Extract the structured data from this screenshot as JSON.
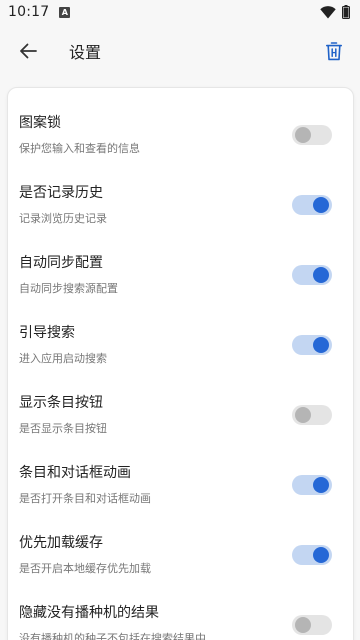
{
  "status_bar": {
    "time": "10:17",
    "notification_icon": "A",
    "icons": [
      "wifi-icon",
      "battery-icon"
    ]
  },
  "app_bar": {
    "title": "设置",
    "back_icon": "arrow-left-icon",
    "action_icon": "trash-icon"
  },
  "colors": {
    "accent": "#2668d6",
    "toggle_on_track": "#c3d6f2",
    "toggle_off_track": "#e4e4e4",
    "toggle_off_knob": "#b5b5b5"
  },
  "settings": [
    {
      "title": "图案锁",
      "description": "保护您输入和查看的信息",
      "enabled": false
    },
    {
      "title": "是否记录历史",
      "description": "记录浏览历史记录",
      "enabled": true
    },
    {
      "title": "自动同步配置",
      "description": "自动同步搜索源配置",
      "enabled": true
    },
    {
      "title": "引导搜索",
      "description": "进入应用启动搜索",
      "enabled": true
    },
    {
      "title": "显示条目按钮",
      "description": "是否显示条目按钮",
      "enabled": false
    },
    {
      "title": "条目和对话框动画",
      "description": "是否打开条目和对话框动画",
      "enabled": true
    },
    {
      "title": "优先加载缓存",
      "description": "是否开启本地缓存优先加载",
      "enabled": true
    },
    {
      "title": "隐藏没有播种机的结果",
      "description": "没有播种机的种子不包括在搜索结果中",
      "enabled": false
    }
  ]
}
